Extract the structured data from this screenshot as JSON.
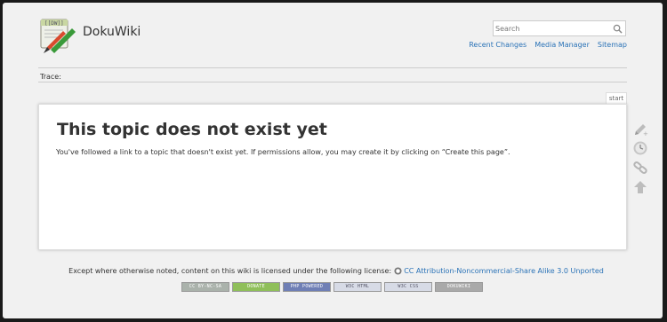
{
  "header": {
    "wiki_title": "DokuWiki",
    "search_placeholder": "Search",
    "links": [
      "Recent Changes",
      "Media Manager",
      "Sitemap"
    ]
  },
  "breadcrumb": {
    "label": "Trace:"
  },
  "page_tab": "start",
  "main": {
    "heading": "This topic does not exist yet",
    "body": "You've followed a link to a topic that doesn't exist yet. If permissions allow, you may create it by clicking on “Create this page”."
  },
  "page_tools": [
    "create-page-icon",
    "old-revisions-icon",
    "backlinks-icon",
    "back-to-top-icon"
  ],
  "footer": {
    "license_text": "Except where otherwise noted, content on this wiki is licensed under the following license:",
    "license_link": "CC Attribution-Noncommercial-Share Alike 3.0 Unported",
    "badges": [
      {
        "label": "CC BY-NC-SA",
        "color": "#aab2ab",
        "width": 54
      },
      {
        "label": "DONATE",
        "color": "#8fbf5a",
        "width": 54
      },
      {
        "label": "PHP POWERED",
        "color": "#6f7fb5",
        "width": 54
      },
      {
        "label": "W3C HTML",
        "color": "#d7dbe6",
        "width": 54
      },
      {
        "label": "W3C CSS",
        "color": "#d7dbe6",
        "width": 54
      },
      {
        "label": "DOKUWIKI",
        "color": "#a9a9a9",
        "width": 54
      }
    ]
  },
  "colors": {
    "link": "#2b73b7",
    "text": "#333333",
    "frame": "#f1f1f1"
  }
}
